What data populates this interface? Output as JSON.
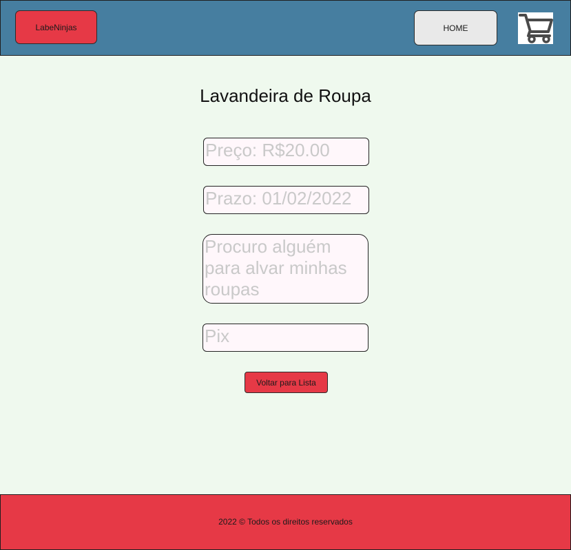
{
  "header": {
    "logo_label": "LabeNinjas",
    "home_label": "HOME",
    "cart_icon": "shopping-cart-icon"
  },
  "main": {
    "title": "Lavandeira de Roupa",
    "fields": {
      "price": "Preço: R$20.00",
      "deadline": "Prazo: 01/02/2022",
      "description": "Procuro alguém para alvar minhas roupas",
      "payment": "Pix"
    },
    "back_button_label": "Voltar para Lista"
  },
  "footer": {
    "text": "2022 © Todos os direitos reservados"
  },
  "colors": {
    "header_bg": "#467ea0",
    "accent_red": "#e63946",
    "page_bg": "#eff9ee",
    "field_bg": "#fff7fb",
    "placeholder_text": "#c9c9c9"
  }
}
